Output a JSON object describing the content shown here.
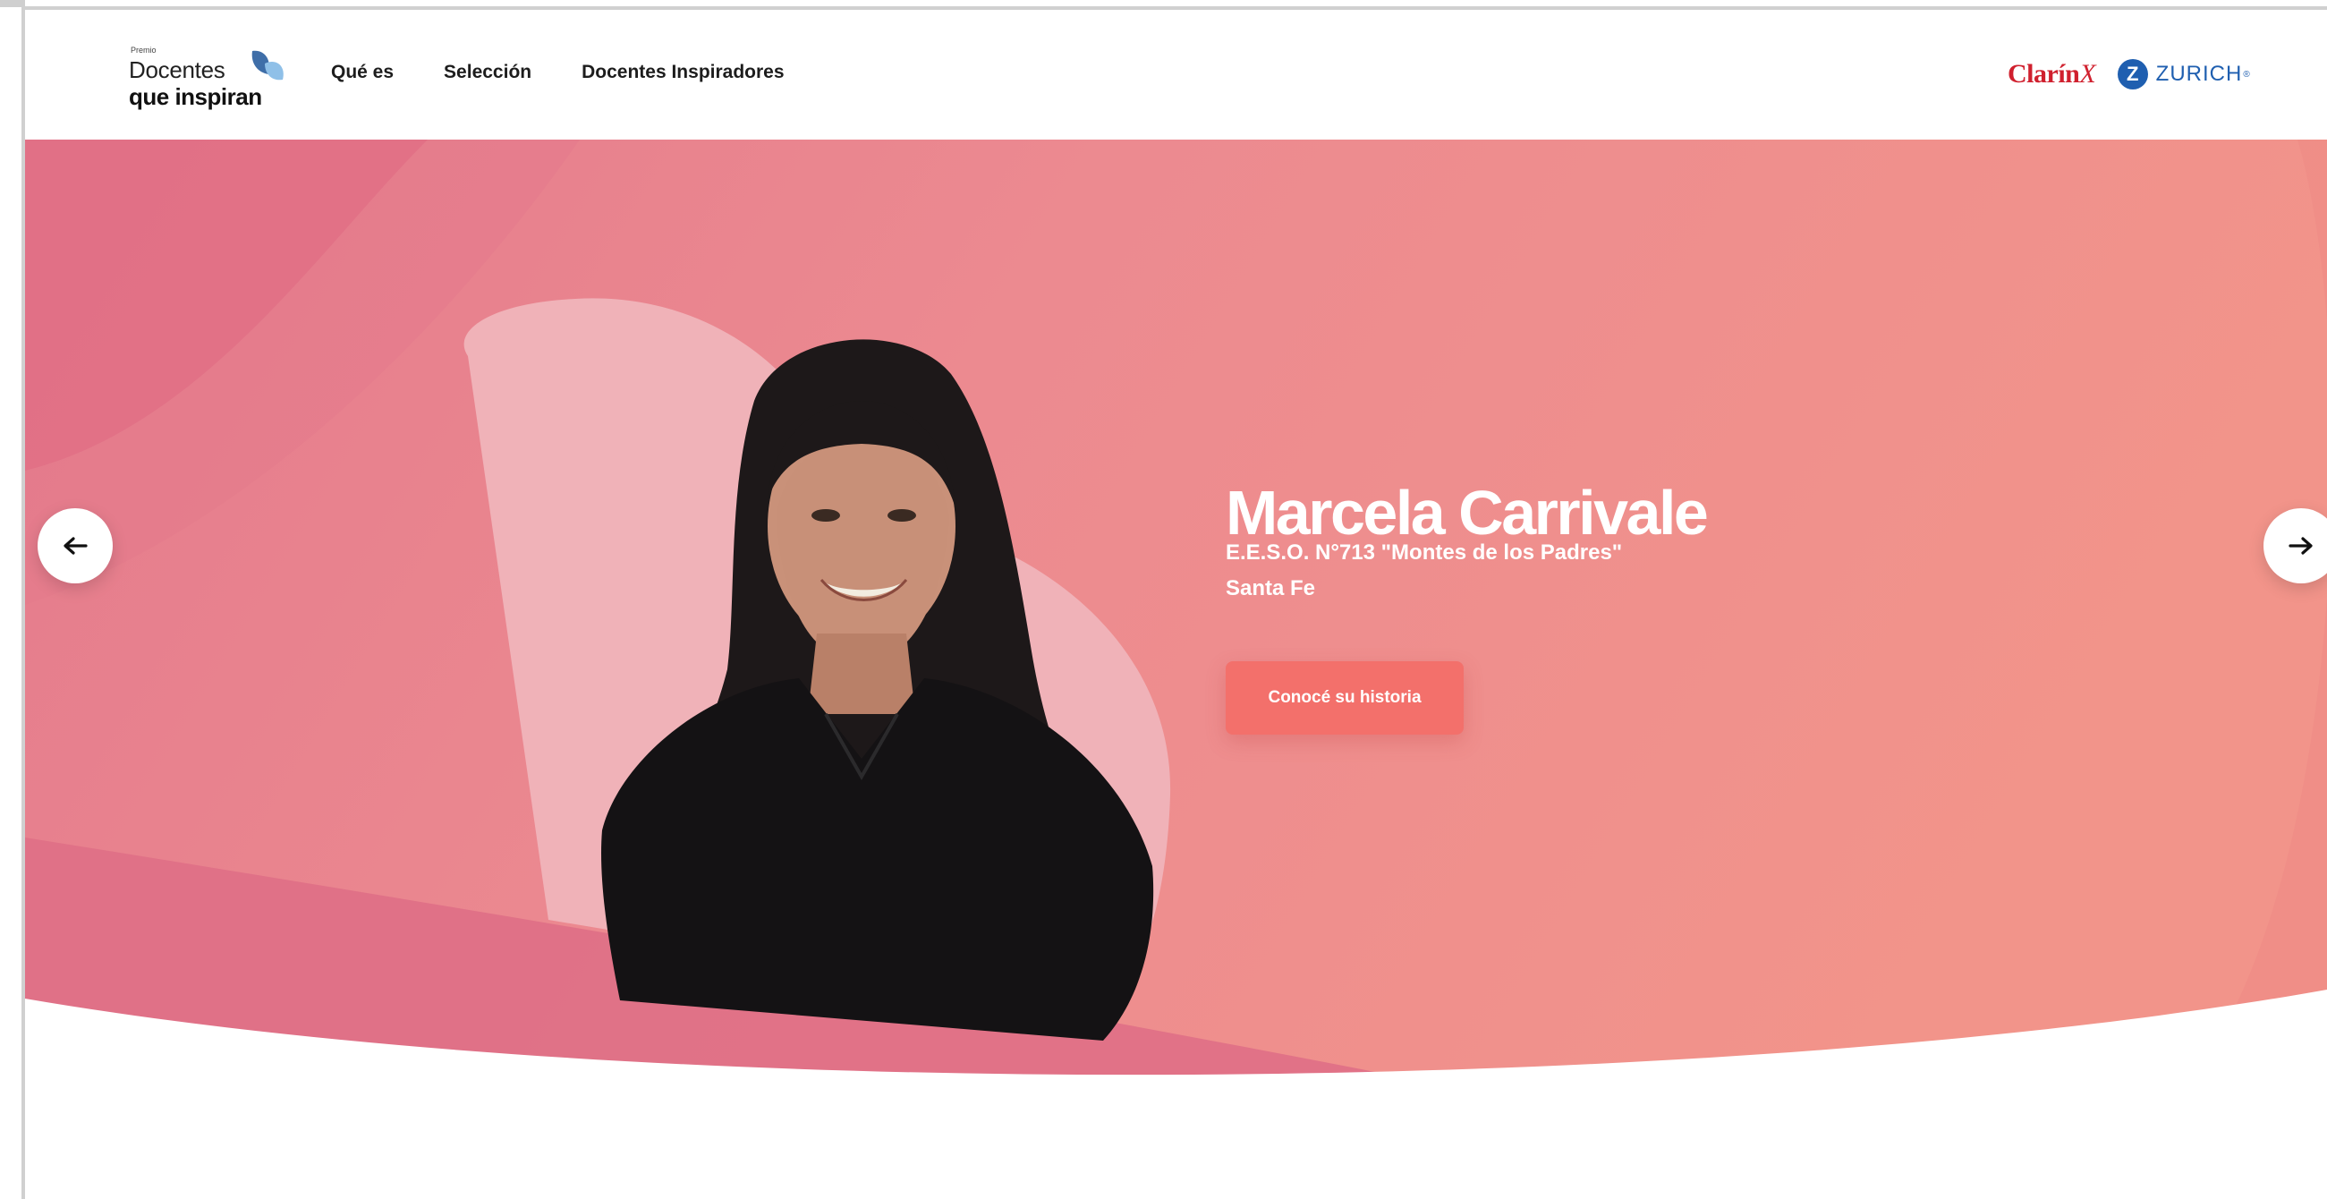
{
  "header": {
    "logo": {
      "small": "Premio",
      "line1": "Docentes",
      "line2": "que inspiran"
    },
    "nav": [
      {
        "label": "Qué es"
      },
      {
        "label": "Selección"
      },
      {
        "label": "Docentes Inspiradores"
      }
    ],
    "sponsors": {
      "clarin": "Clarín",
      "clarin_mark": "X",
      "zurich_letter": "Z",
      "zurich": "ZURICH",
      "zurich_reg": "®"
    }
  },
  "hero": {
    "name": "Marcela Carrivale",
    "school": "E.E.S.O. N°713 \"Montes de los Padres\"",
    "province": "Santa Fe",
    "cta": "Conocé su historia",
    "prev_icon": "arrow-left-icon",
    "next_icon": "arrow-right-icon"
  },
  "colors": {
    "hero_left": "#e0728a",
    "hero_right": "#f0958a",
    "cta": "#f3706b",
    "zurich_blue": "#1f5fb0",
    "clarin_red": "#d0202e"
  }
}
